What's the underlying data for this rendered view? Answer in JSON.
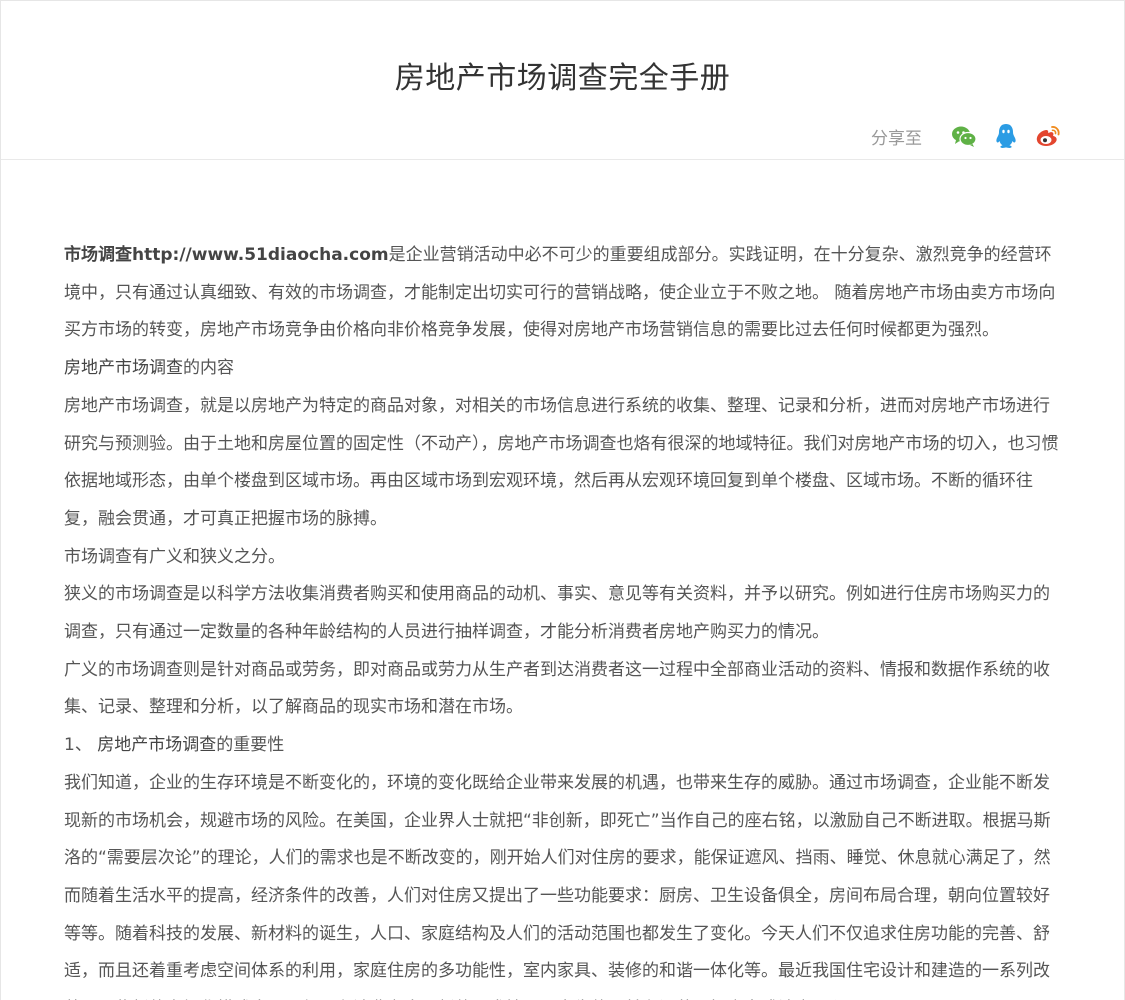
{
  "article": {
    "title": "房地产市场调查完全手册",
    "share_label": "分享至"
  },
  "share_icons": [
    "wechat-icon",
    "qq-icon",
    "weibo-icon"
  ],
  "colors": {
    "wechat": "#5fb146",
    "qq": "#2b9ce4",
    "weibo": "#e3462f"
  },
  "body": {
    "intro_link": "市场调查http://www.51diaocha.com",
    "intro_rest": "是企业营销活动中必不可少的重要组成部分。实践证明，在十分复杂、激烈竞争的经营环境中，只有通过认真细致、有效的市场调查，才能制定出切实可行的营销战略，使企业立于不败之地。 随着房地产市场由卖方市场向买方市场的转变，房地产市场竞争由价格向非价格竞争发展，使得对房地产市场营销信息的需要比过去任何时候都更为强烈。",
    "h1_term": "房地产市场调查",
    "h1_rest": "的内容",
    "p2": "房地产市场调查，就是以房地产为特定的商品对象，对相关的市场信息进行系统的收集、整理、记录和分析，进而对房地产市场进行研究与预测验。由于土地和房屋位置的固定性（不动产），房地产市场调查也烙有很深的地域特征。我们对房地产市场的切入，也习惯依据地域形态，由单个楼盘到区域市场。再由区域市场到宏观环境，然后再从宏观环境回复到单个楼盘、区域市场。不断的循环往复，融会贯通，才可真正把握市场的脉搏。",
    "p3": "市场调查有广义和狭义之分。",
    "p4": "狭义的市场调查是以科学方法收集消费者购买和使用商品的动机、事实、意见等有关资料，并予以研究。例如进行住房市场购买力的调查，只有通过一定数量的各种年龄结构的人员进行抽样调查，才能分析消费者房地产购买力的情况。",
    "p5": "广义的市场调查则是针对商品或劳务，即对商品或劳力从生产者到达消费者这一过程中全部商业活动的资料、情报和数据作系统的收集、记录、整理和分析，以了解商品的现实市场和潜在市场。",
    "h2_prefix": "1、 ",
    "h2_term": "房地产市场调查",
    "h2_rest": "的重要性",
    "p6": "我们知道，企业的生存环境是不断变化的，环境的变化既给企业带来发展的机遇，也带来生存的威胁。通过市场调查，企业能不断发现新的市场机会，规避市场的风险。在美国，企业界人士就把“非创新，即死亡”当作自己的座右铭，以激励自己不断进取。根据马斯洛的“需要层次论”的理论，人们的需求也是不断改变的，刚开始人们对住房的要求，能保证遮风、挡雨、睡觉、休息就心满足了，然而随着生活水平的提高，经济条件的改善，人们对住房又提出了一些功能要求：厨房、卫生设备俱全，房间布局合理，朝向位置较好等等。随着科技的发展、新材料的诞生，人口、家庭结构及人们的活动范围也都发生了变化。今天人们不仅追求住房功能的完善、舒适，而且还着重考虑空间体系的利用，家庭住房的多功能性，室内家具、装修的和谐一体化等。最近我国住宅设计和建造的一系列改革，一些新的市场化模式出现，便是在消费者出现新的要求情况下产生的，并在还艺无损方向或该点工程，目"
  }
}
